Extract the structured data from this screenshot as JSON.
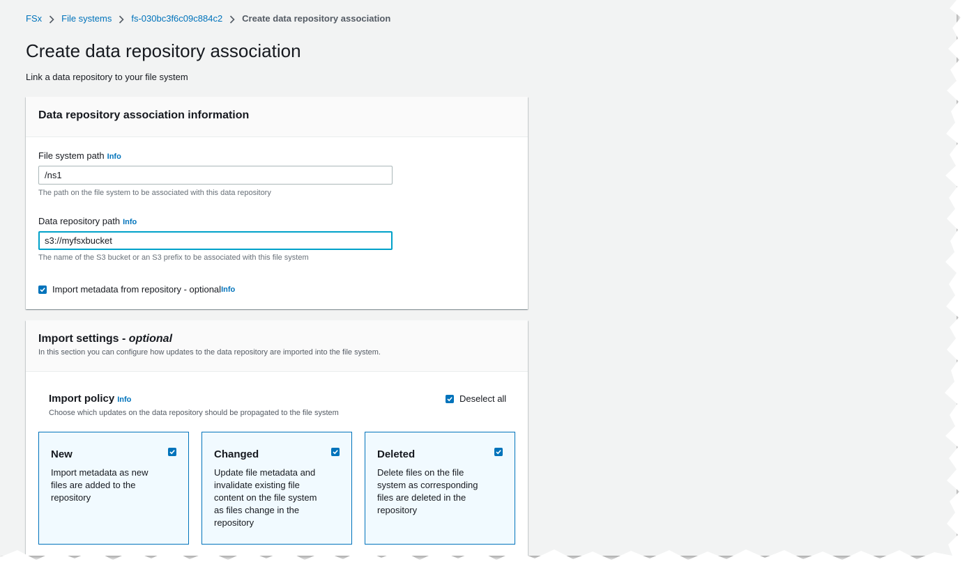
{
  "breadcrumb": {
    "items": [
      "FSx",
      "File systems",
      "fs-030bc3f6c09c884c2"
    ],
    "current": "Create data repository association"
  },
  "header": {
    "title": "Create data repository association",
    "description": "Link a data repository to your file system"
  },
  "association_panel": {
    "title": "Data repository association information",
    "fs_path": {
      "label": "File system path",
      "info": "Info",
      "value": "/ns1",
      "hint": "The path on the file system to be associated with this data repository"
    },
    "repo_path": {
      "label": "Data repository path",
      "info": "Info",
      "value": "s3://myfsxbucket",
      "hint": "The name of the S3 bucket or an S3 prefix to be associated with this file system"
    },
    "import_metadata": {
      "label": "Import metadata from repository - optional",
      "info": "Info",
      "checked": true
    }
  },
  "import_panel": {
    "title": "Import settings -",
    "title_optional": "optional",
    "subtitle": "In this section you can configure how updates to the data repository are imported into the file system.",
    "policy": {
      "title": "Import policy",
      "info": "Info",
      "description": "Choose which updates on the data repository should be propagated to the file system",
      "deselect_all": "Deselect all",
      "tiles": [
        {
          "title": "New",
          "description": "Import metadata as new files are added to the repository",
          "checked": true
        },
        {
          "title": "Changed",
          "description": "Update file metadata and invalidate existing file content on the file system as files change in the repository",
          "checked": true
        },
        {
          "title": "Deleted",
          "description": "Delete files on the file system as corresponding files are deleted in the repository",
          "checked": true
        }
      ]
    }
  },
  "colors": {
    "link": "#0073bb",
    "focus": "#00a1c9",
    "tile_bg": "#f1faff",
    "page_bg": "#f2f3f3"
  }
}
